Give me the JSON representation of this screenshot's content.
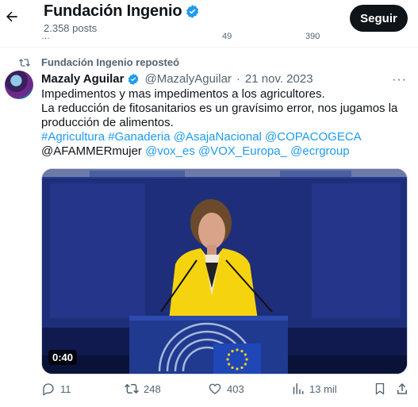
{
  "header": {
    "title": "Fundación Ingenio",
    "posts": "2.358 posts",
    "follow_label": "Seguir",
    "peek_counts": [
      "…",
      "49",
      "390"
    ]
  },
  "repost": {
    "label": "Fundación Ingenio reposteó"
  },
  "tweet": {
    "author_name": "Mazaly Aguilar",
    "handle": "@MazalyAguilar",
    "separator": "·",
    "date": "21 nov. 2023",
    "more": "···",
    "lines": [
      "Impedimentos y mas impedimentos a los agricultores.",
      "La reducción de fitosanitarios es un gravísimo error, nos jugamos la",
      "producción de alimentos."
    ],
    "tags_line1": "#Agricultura #Ganaderia @AsajaNacional @COPACOGECA",
    "line2_plain": "@AFAMMERmujer ",
    "line2_links": "@vox_es @VOX_Europa_ @ecrgroup",
    "video_duration": "0:40"
  },
  "actions": {
    "replies": "11",
    "reposts": "248",
    "likes": "403",
    "views": "13 mil"
  },
  "colors": {
    "accent": "#1d9bf0",
    "text": "#0f1419",
    "muted": "#536471",
    "verified": "#1d9bf0",
    "follow_bg": "#0f1419",
    "blazer": "#f5d40f",
    "podium": "#1f3a8f"
  },
  "icons": {
    "back": "arrow-left-icon",
    "verified": "verified-badge-icon",
    "repost": "repost-icon",
    "reply": "reply-icon",
    "like": "heart-icon",
    "views": "bar-chart-icon",
    "bookmark": "bookmark-icon",
    "share": "share-icon",
    "eu": "eu-flag-icon"
  }
}
